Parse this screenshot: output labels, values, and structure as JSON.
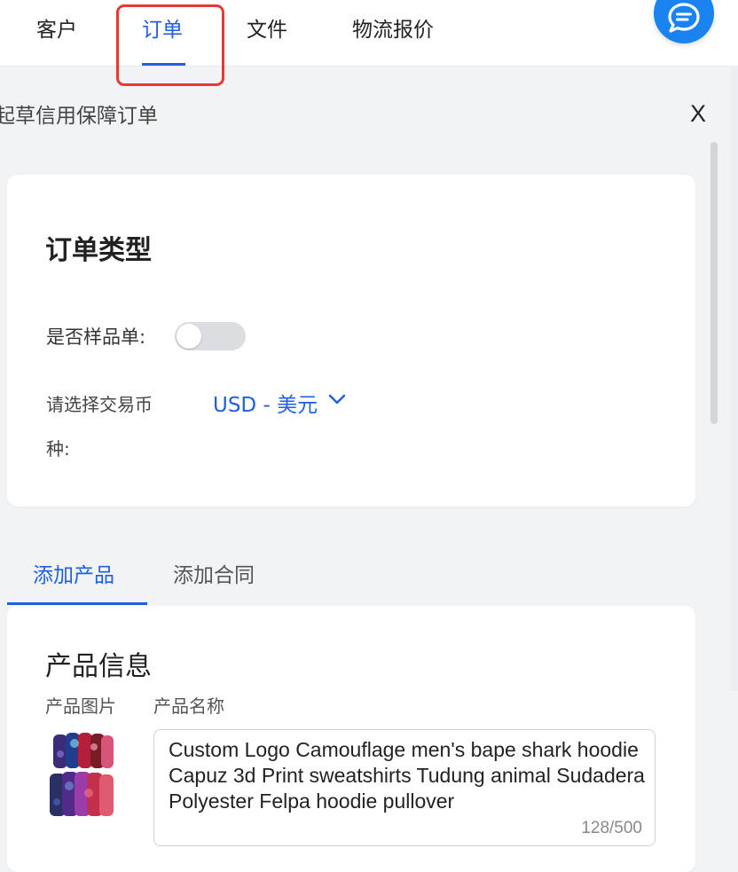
{
  "nav": {
    "tabs": [
      {
        "label": "客户",
        "active": false
      },
      {
        "label": "订单",
        "active": true
      },
      {
        "label": "文件",
        "active": false
      },
      {
        "label": "物流报价",
        "active": false
      }
    ],
    "chat_icon": "chat-bubble-icon"
  },
  "panel": {
    "title": "起草信用保障订单",
    "close_label": "X"
  },
  "order_type": {
    "title": "订单类型",
    "sample_label": "是否样品单:",
    "sample_enabled": false,
    "currency_label_line1": "请选择交易币",
    "currency_label_line2": "种:",
    "currency_value": "USD - 美元"
  },
  "sub_tabs": [
    {
      "label": "添加产品",
      "active": true
    },
    {
      "label": "添加合同",
      "active": false
    }
  ],
  "product": {
    "title": "产品信息",
    "image_header": "产品图片",
    "name_header": "产品名称",
    "name_value": "Custom Logo Camouflage men's bape shark hoodie Capuz 3d Print sweatshirts Tudung animal Sudadera Polyester Felpa hoodie pullover",
    "char_count": "128/500"
  },
  "colors": {
    "accent": "#1f5fe0",
    "highlight": "#e53935",
    "chat_button": "#1b83f0"
  }
}
